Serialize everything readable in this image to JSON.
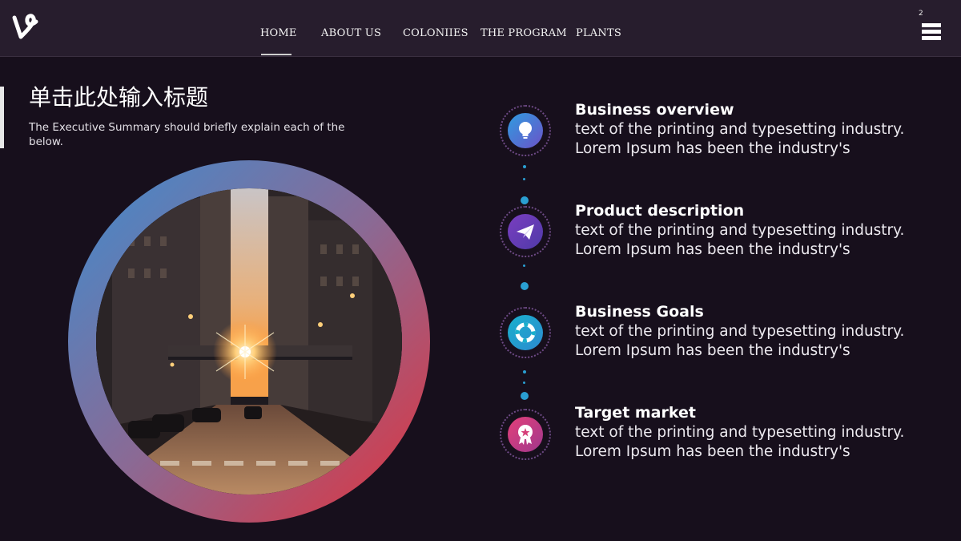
{
  "header": {
    "nav": [
      "HOME",
      "ABOUT US",
      "COLONIIES",
      "THE PROGRAM",
      "PLANTS"
    ],
    "page_number": "2"
  },
  "slide": {
    "title": "单击此处输入标题",
    "subtitle": "The Executive Summary should briefly explain each of the below."
  },
  "photo": {
    "description_icon": "city-street-sunset-photo"
  },
  "items": [
    {
      "title": "Business overview",
      "text": "text of the printing and typesetting industry. Lorem Ipsum has been the industry's",
      "icon": "lightbulb-icon",
      "color": "#3f7fd0"
    },
    {
      "title": "Product description",
      "text": "text of the printing and typesetting industry. Lorem Ipsum has been the industry's",
      "icon": "paper-plane-icon",
      "color": "#6a3fb0"
    },
    {
      "title": "Business Goals",
      "text": "text of the printing and typesetting industry. Lorem Ipsum has been the industry's",
      "icon": "lifebuoy-icon",
      "color": "#21a8c4"
    },
    {
      "title": "Target market",
      "text": "text of the printing and typesetting industry. Lorem Ipsum has been the industry's",
      "icon": "award-ribbon-icon",
      "color": "#d6407a"
    }
  ],
  "colors": {
    "accent_blue": "#2a9fd2",
    "ring_start": "#3e8ccf",
    "ring_end": "#e3323c"
  }
}
